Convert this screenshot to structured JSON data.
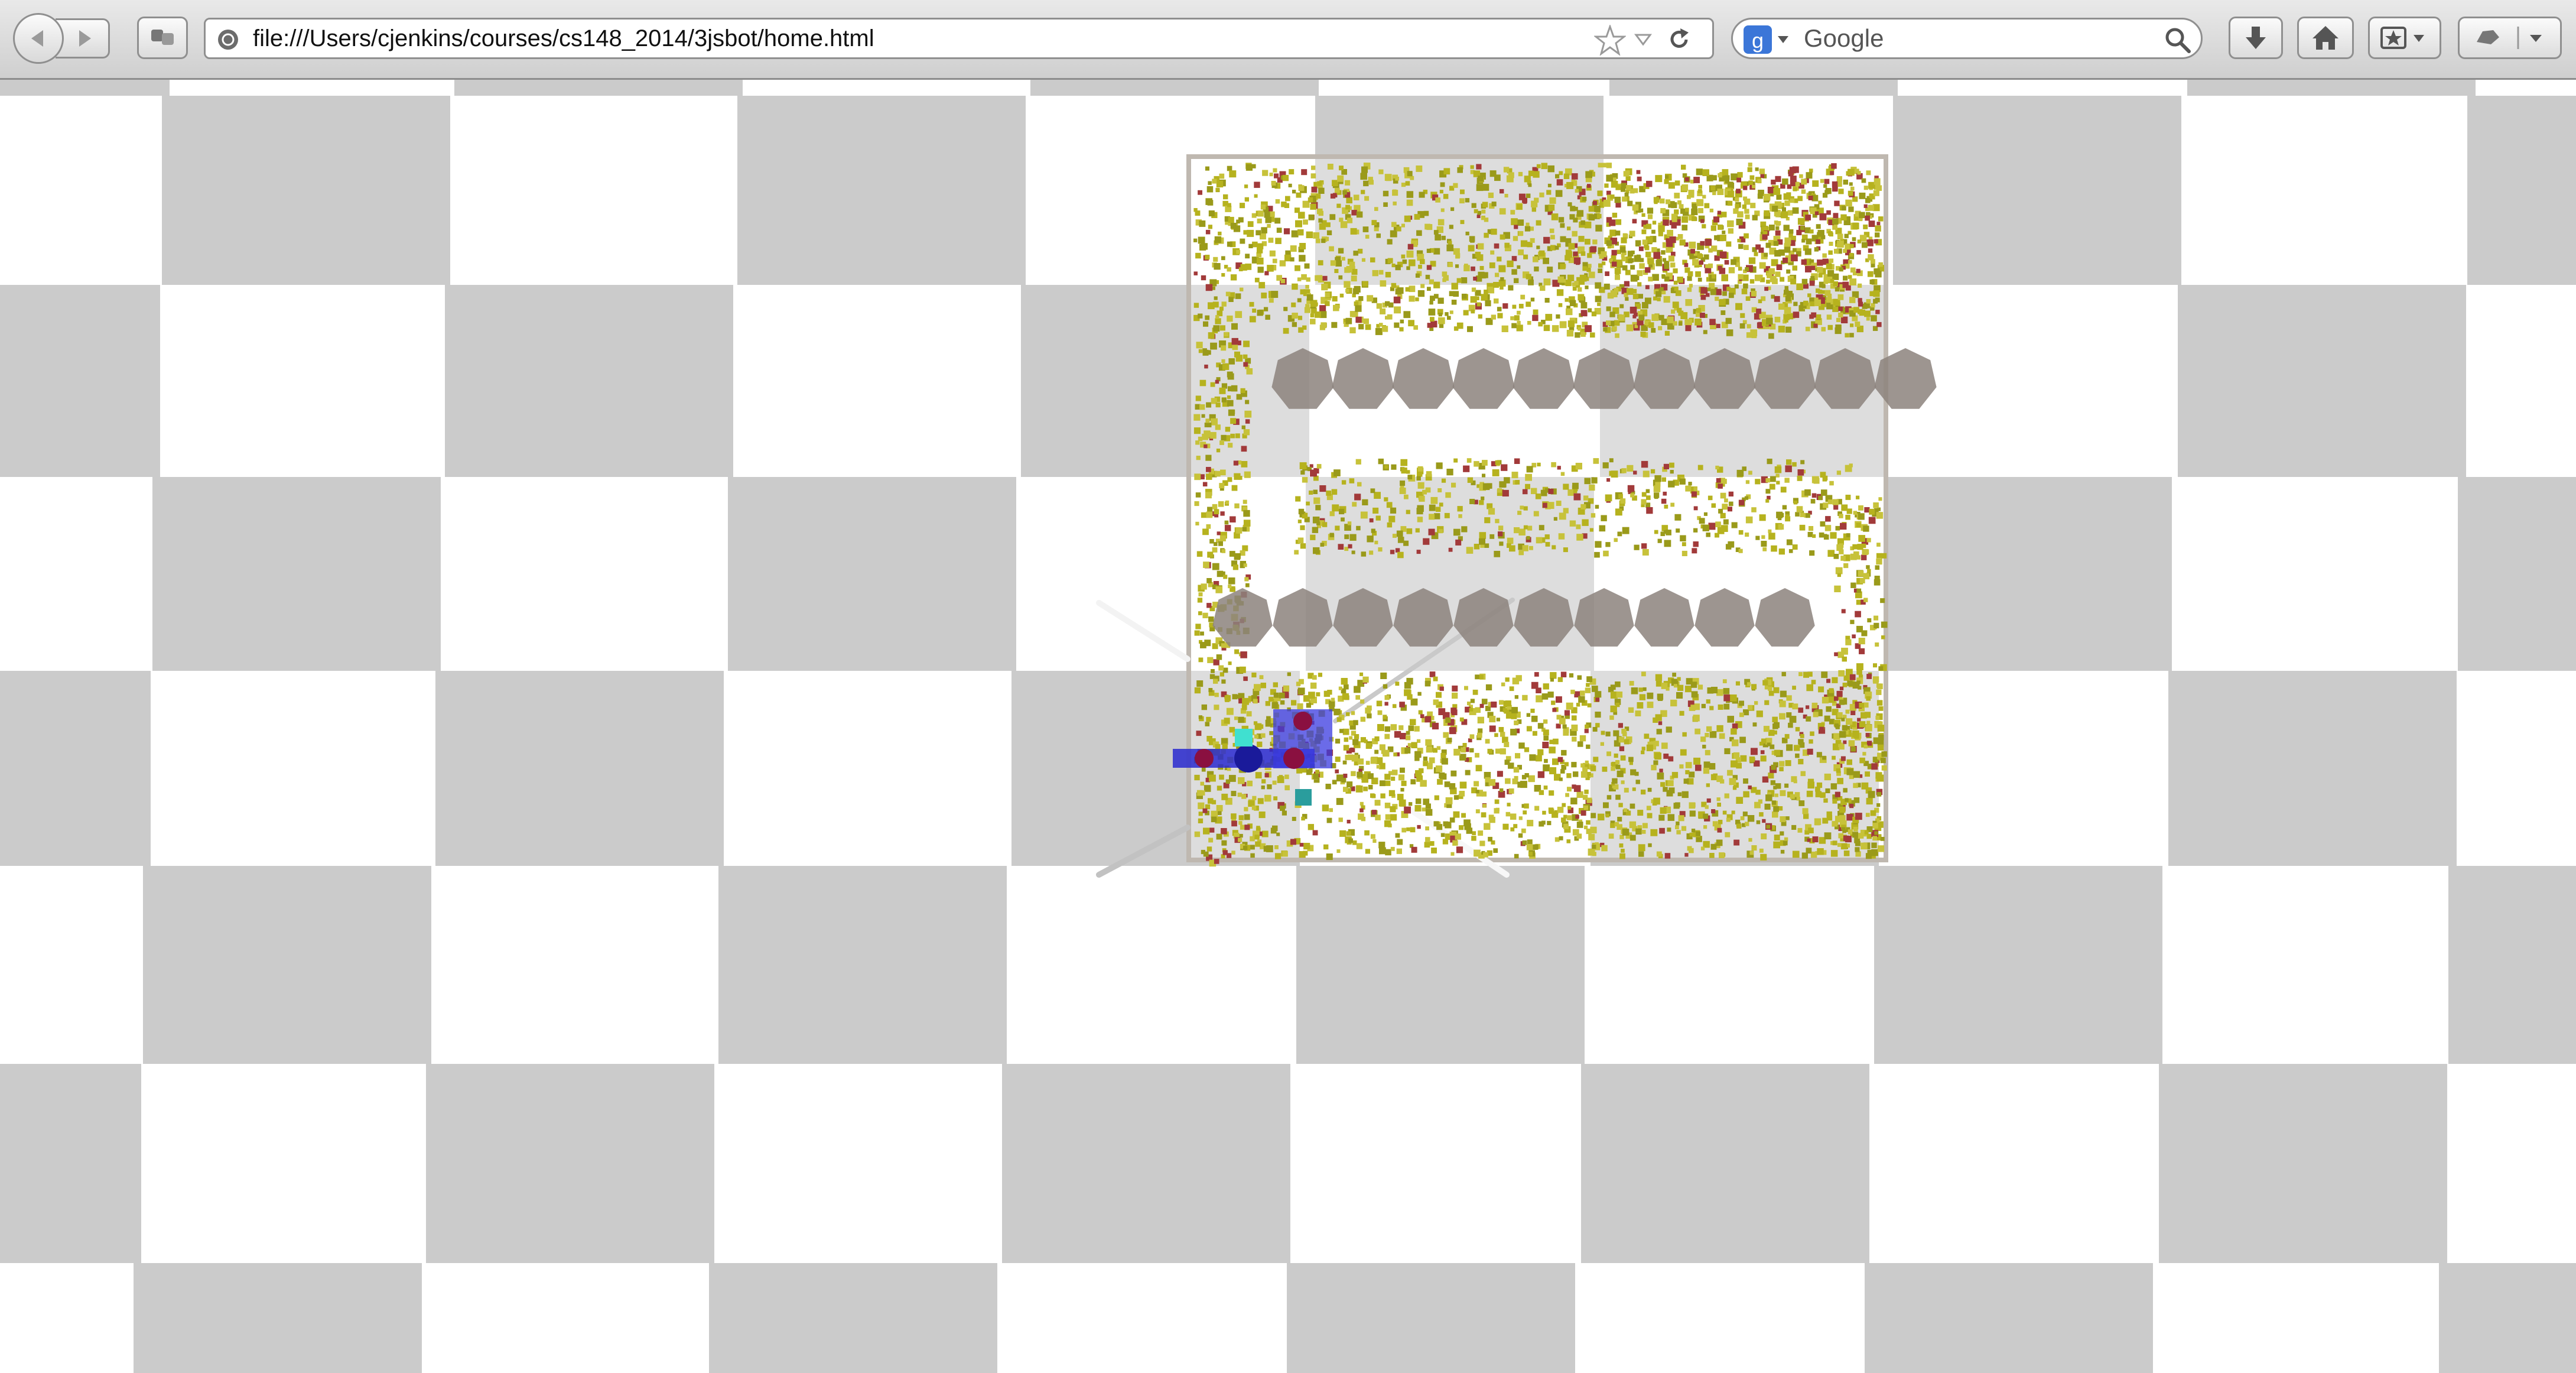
{
  "toolbar": {
    "url": "file:///Users/cjenkins/courses/cs148_2014/3jsbot/home.html",
    "search_placeholder": "Google",
    "icons": [
      "back-arrow",
      "forward-arrow",
      "tab-groups",
      "site-identity",
      "bookmark-star",
      "dropmarker",
      "reload",
      "google-logo",
      "search-magnifier",
      "download-arrow",
      "home",
      "bookmarks-menu",
      "extension-menu"
    ]
  },
  "scene": {
    "floor_colors": {
      "light": "#ffffff",
      "dark": "#cbcbcb"
    },
    "particle_colors": [
      "#b6b21e",
      "#c7c23a",
      "#9a9a1a",
      "#a23a3a"
    ],
    "obstacle_color": "#8c837c",
    "robot_colors": {
      "body": "#2a2ad0",
      "joint": "#8a1040",
      "endpoint": "#40e0d0",
      "target": "#2a9d9d"
    }
  }
}
